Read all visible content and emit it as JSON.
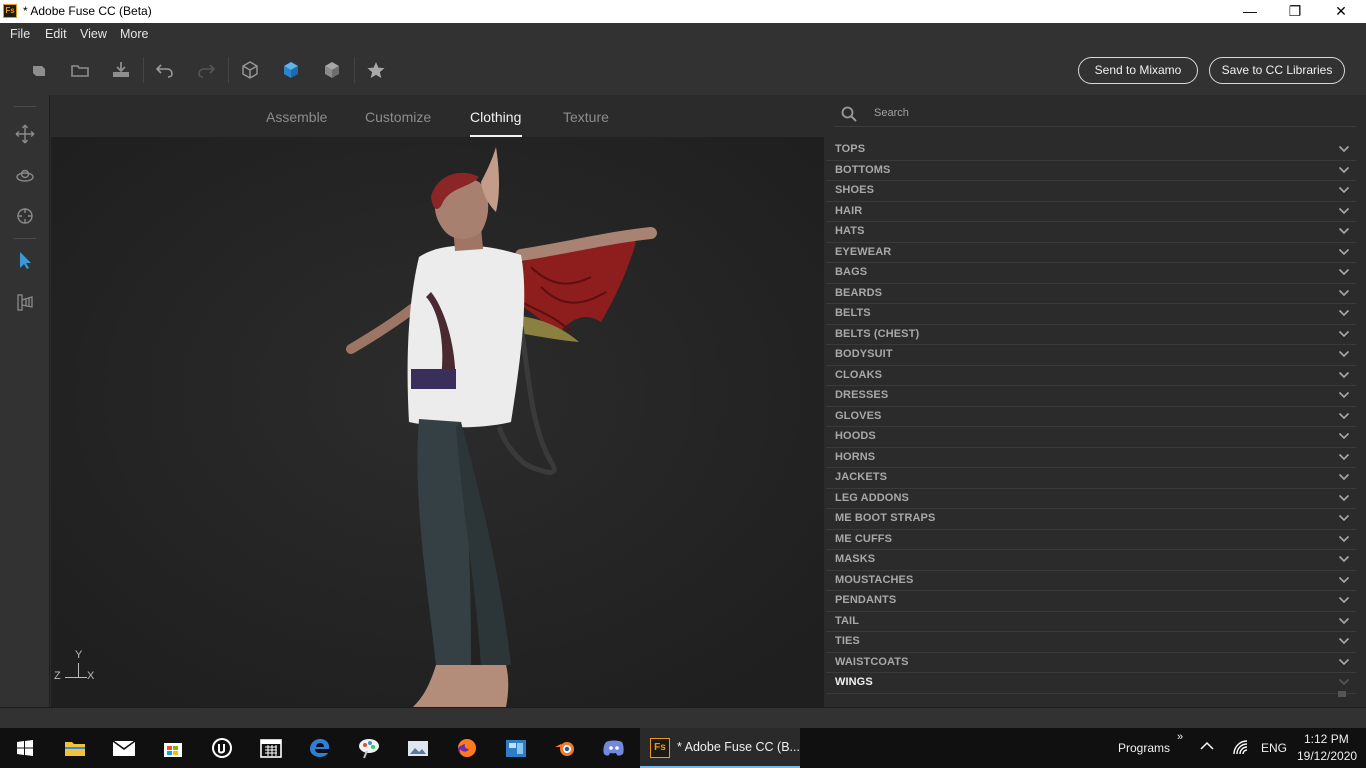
{
  "window": {
    "app_icon": "Fs",
    "title": "* Adobe Fuse CC (Beta)",
    "controls": {
      "minimize": "—",
      "restore": "❐",
      "close": "✕"
    }
  },
  "menu": [
    "File",
    "Edit",
    "View",
    "More"
  ],
  "toolbar": {
    "icons": [
      "new-icon",
      "open-folder-icon",
      "import-icon",
      "undo-icon",
      "redo-icon",
      "cube-wireframe-icon",
      "cube-solid-icon",
      "cube-shaded-icon",
      "star-icon"
    ],
    "send_label": "Send to Mixamo",
    "save_label": "Save to CC Libraries"
  },
  "left_tools": [
    "move-icon",
    "orbit-icon",
    "target-icon",
    "select-pointer-icon",
    "camera-views-icon"
  ],
  "tabs": [
    {
      "label": "Assemble",
      "active": false
    },
    {
      "label": "Customize",
      "active": false
    },
    {
      "label": "Clothing",
      "active": true
    },
    {
      "label": "Texture",
      "active": false
    }
  ],
  "viewport": {
    "axes": {
      "y": "Y",
      "z": "Z",
      "x": "X"
    }
  },
  "search": {
    "placeholder": "Search"
  },
  "categories": [
    "TOPS",
    "BOTTOMS",
    "SHOES",
    "HAIR",
    "HATS",
    "EYEWEAR",
    "BAGS",
    "BEARDS",
    "BELTS",
    "BELTS (CHEST)",
    "BODYSUIT",
    "CLOAKS",
    "DRESSES",
    "GLOVES",
    "HOODS",
    "HORNS",
    "JACKETS",
    "LEG ADDONS",
    "ME BOOT STRAPS",
    "ME CUFFS",
    "MASKS",
    "MOUSTACHES",
    "PENDANTS",
    "TAIL",
    "TIES",
    "WAISTCOATS",
    "WINGS"
  ],
  "taskbar": {
    "pinned": [
      "start-icon",
      "file-explorer-icon",
      "mail-icon",
      "store-icon",
      "unreal-engine-icon",
      "calendar-icon",
      "edge-icon",
      "paint-icon",
      "photos-icon",
      "firefox-icon",
      "app-icon",
      "blender-icon",
      "discord-icon"
    ],
    "active_app_icon": "Fs",
    "active_app": "* Adobe Fuse CC (B...",
    "programs": "Programs",
    "programs_chevron": "»",
    "language": "ENG",
    "time": "1:12 PM",
    "date": "19/12/2020"
  },
  "colors": {
    "accent": "#3a9ad9",
    "panel": "#2b2b2b",
    "chrome": "#323232",
    "viewport": "#242424"
  }
}
